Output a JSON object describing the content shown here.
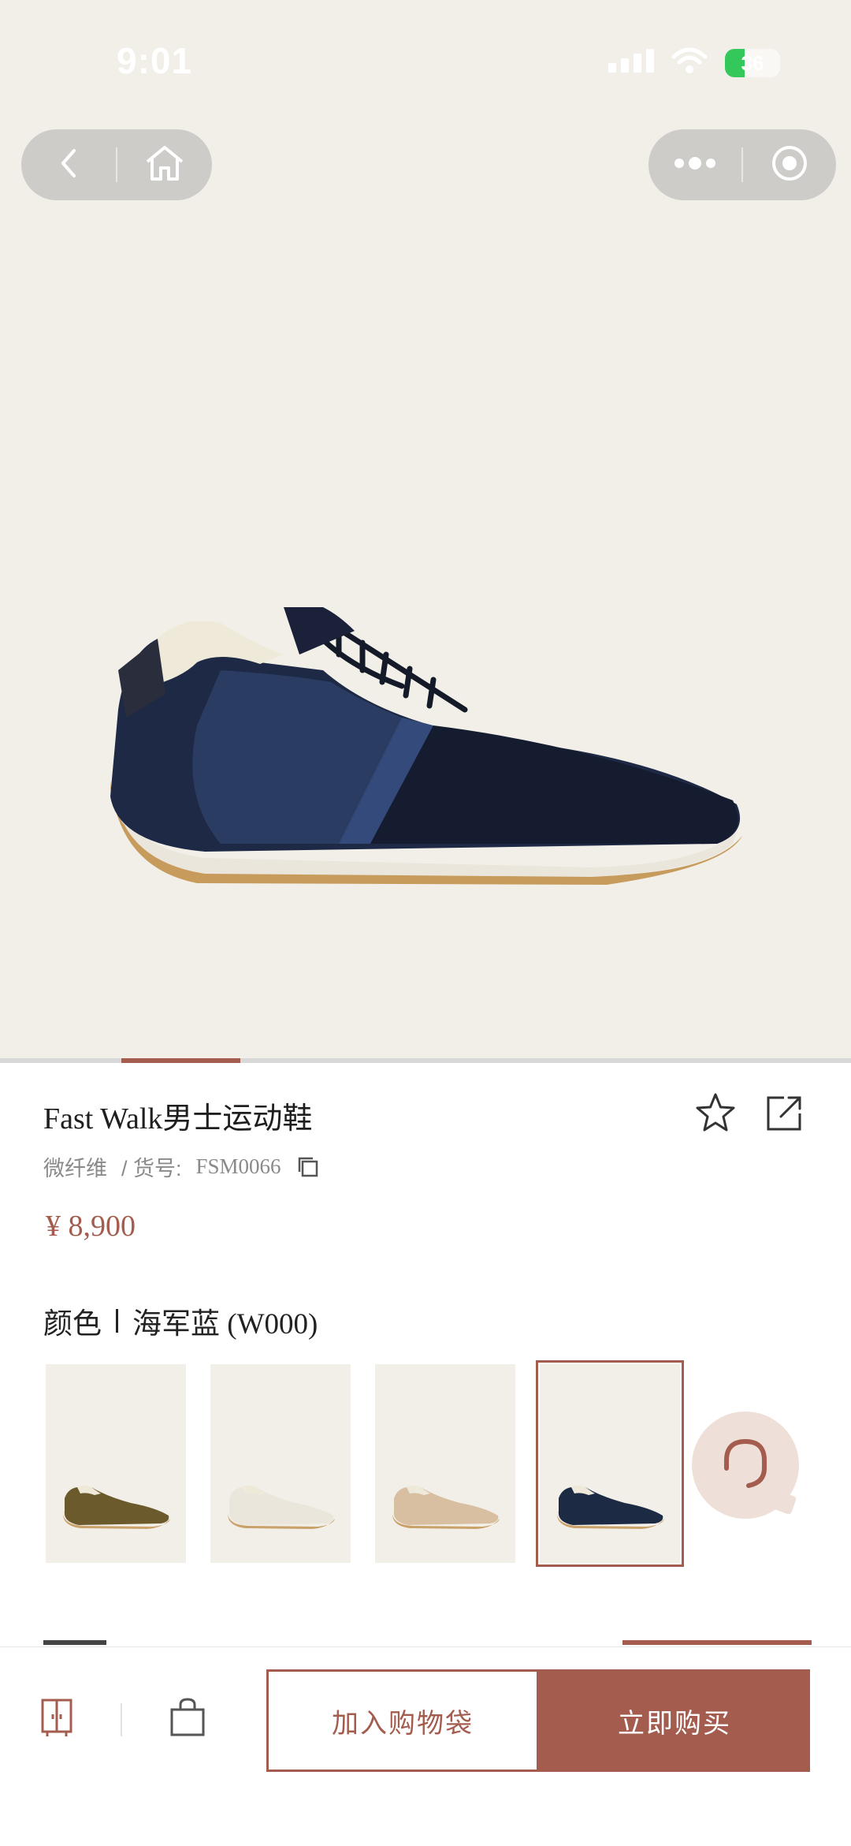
{
  "status_bar": {
    "time": "9:01",
    "battery": "36",
    "battery_level": 0.36,
    "icons": [
      "signal-icon",
      "wifi-icon",
      "battery-icon"
    ]
  },
  "nav": {
    "left_icons": [
      "back-icon",
      "home-icon"
    ],
    "right_icons": [
      "more-icon",
      "close-miniapp-icon"
    ]
  },
  "gallery": {
    "image_description": "navy suede and nylon men's sneaker",
    "progress": 0.14
  },
  "product": {
    "title": "Fast Walk男士运动鞋",
    "material": "微纤维",
    "sku_label": "/ 货号:",
    "sku": "FSM0066",
    "price": "¥ 8,900"
  },
  "color": {
    "label": "颜色",
    "selected_value": "海军蓝 (W000)",
    "swatches": [
      {
        "color": "#6b5a2c",
        "selected": false
      },
      {
        "color": "#ebe6dc",
        "selected": false
      },
      {
        "color": "#d9bfa2",
        "selected": false
      },
      {
        "color": "#1d2a44",
        "selected": true
      }
    ]
  },
  "bottom_bar": {
    "add_to_bag": "加入购物袋",
    "buy_now": "立即购买",
    "icons": [
      "wardrobe-icon",
      "shopping-bag-icon"
    ]
  },
  "colors": {
    "accent": "#a35c4e",
    "hero_bg": "#f2efe9",
    "support_bg": "#eedfd8"
  }
}
